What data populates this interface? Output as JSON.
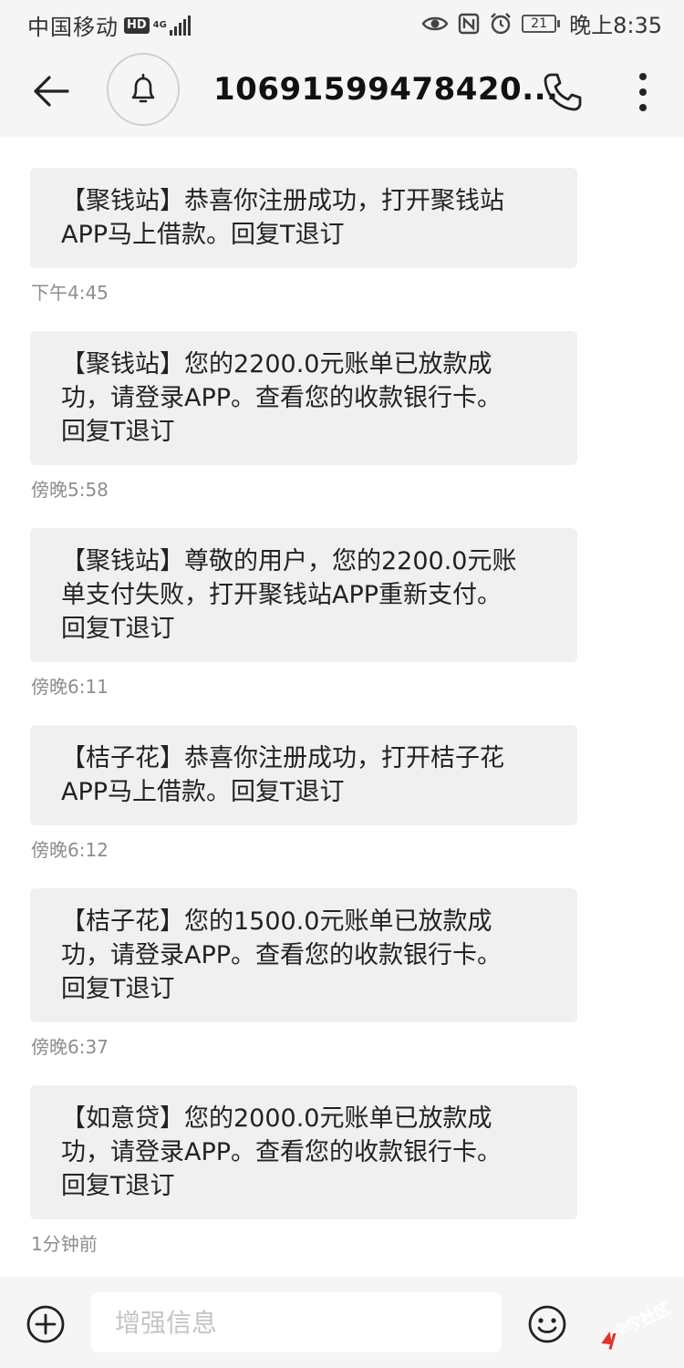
{
  "status_bar": {
    "carrier": "中国移动",
    "hd": "HD",
    "net_type": "4G",
    "battery_level": "21",
    "time": "晚上8:35",
    "icons": [
      "eye-icon",
      "nfc-icon",
      "alarm-icon",
      "battery-icon"
    ]
  },
  "header": {
    "title": "10691599478420...",
    "icons": [
      "back-arrow-icon",
      "bell-icon",
      "phone-icon",
      "more-vertical-icon"
    ]
  },
  "messages": [
    {
      "lines": [
        "【聚钱站】恭喜你注册成功，打开聚钱站",
        "APP马上借款。回复T退订"
      ],
      "time": "下午4:45"
    },
    {
      "lines": [
        "【聚钱站】您的2200.0元账单已放款成",
        "功，请登录APP。查看您的收款银行卡。",
        "回复T退订"
      ],
      "time": "傍晚5:58"
    },
    {
      "lines": [
        "【聚钱站】尊敬的用户，您的2200.0元账",
        "单支付失败，打开聚钱站APP重新支付。",
        "回复T退订"
      ],
      "time": "傍晚6:11"
    },
    {
      "lines": [
        "【桔子花】恭喜你注册成功，打开桔子花",
        "APP马上借款。回复T退订"
      ],
      "time": "傍晚6:12"
    },
    {
      "lines": [
        "【桔子花】您的1500.0元账单已放款成",
        "功，请登录APP。查看您的收款银行卡。",
        "回复T退订"
      ],
      "time": "傍晚6:37"
    },
    {
      "lines": [
        "【如意贷】您的2000.0元账单已放款成",
        "功，请登录APP。查看您的收款银行卡。",
        "回复T退订"
      ],
      "time": "1分钟前"
    }
  ],
  "composer": {
    "placeholder": "增强信息",
    "icons": [
      "add-circle-icon",
      "emoji-icon"
    ]
  },
  "watermark": {
    "text": "卡农社区",
    "color": "#e0322f"
  }
}
